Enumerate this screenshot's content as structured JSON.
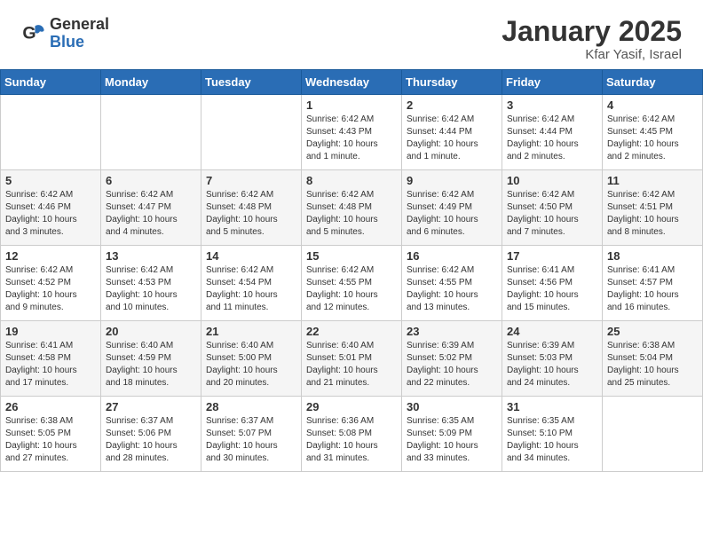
{
  "logo": {
    "general": "General",
    "blue": "Blue"
  },
  "title": "January 2025",
  "location": "Kfar Yasif, Israel",
  "weekdays": [
    "Sunday",
    "Monday",
    "Tuesday",
    "Wednesday",
    "Thursday",
    "Friday",
    "Saturday"
  ],
  "weeks": [
    [
      {
        "day": "",
        "info": ""
      },
      {
        "day": "",
        "info": ""
      },
      {
        "day": "",
        "info": ""
      },
      {
        "day": "1",
        "info": "Sunrise: 6:42 AM\nSunset: 4:43 PM\nDaylight: 10 hours\nand 1 minute."
      },
      {
        "day": "2",
        "info": "Sunrise: 6:42 AM\nSunset: 4:44 PM\nDaylight: 10 hours\nand 1 minute."
      },
      {
        "day": "3",
        "info": "Sunrise: 6:42 AM\nSunset: 4:44 PM\nDaylight: 10 hours\nand 2 minutes."
      },
      {
        "day": "4",
        "info": "Sunrise: 6:42 AM\nSunset: 4:45 PM\nDaylight: 10 hours\nand 2 minutes."
      }
    ],
    [
      {
        "day": "5",
        "info": "Sunrise: 6:42 AM\nSunset: 4:46 PM\nDaylight: 10 hours\nand 3 minutes."
      },
      {
        "day": "6",
        "info": "Sunrise: 6:42 AM\nSunset: 4:47 PM\nDaylight: 10 hours\nand 4 minutes."
      },
      {
        "day": "7",
        "info": "Sunrise: 6:42 AM\nSunset: 4:48 PM\nDaylight: 10 hours\nand 5 minutes."
      },
      {
        "day": "8",
        "info": "Sunrise: 6:42 AM\nSunset: 4:48 PM\nDaylight: 10 hours\nand 5 minutes."
      },
      {
        "day": "9",
        "info": "Sunrise: 6:42 AM\nSunset: 4:49 PM\nDaylight: 10 hours\nand 6 minutes."
      },
      {
        "day": "10",
        "info": "Sunrise: 6:42 AM\nSunset: 4:50 PM\nDaylight: 10 hours\nand 7 minutes."
      },
      {
        "day": "11",
        "info": "Sunrise: 6:42 AM\nSunset: 4:51 PM\nDaylight: 10 hours\nand 8 minutes."
      }
    ],
    [
      {
        "day": "12",
        "info": "Sunrise: 6:42 AM\nSunset: 4:52 PM\nDaylight: 10 hours\nand 9 minutes."
      },
      {
        "day": "13",
        "info": "Sunrise: 6:42 AM\nSunset: 4:53 PM\nDaylight: 10 hours\nand 10 minutes."
      },
      {
        "day": "14",
        "info": "Sunrise: 6:42 AM\nSunset: 4:54 PM\nDaylight: 10 hours\nand 11 minutes."
      },
      {
        "day": "15",
        "info": "Sunrise: 6:42 AM\nSunset: 4:55 PM\nDaylight: 10 hours\nand 12 minutes."
      },
      {
        "day": "16",
        "info": "Sunrise: 6:42 AM\nSunset: 4:55 PM\nDaylight: 10 hours\nand 13 minutes."
      },
      {
        "day": "17",
        "info": "Sunrise: 6:41 AM\nSunset: 4:56 PM\nDaylight: 10 hours\nand 15 minutes."
      },
      {
        "day": "18",
        "info": "Sunrise: 6:41 AM\nSunset: 4:57 PM\nDaylight: 10 hours\nand 16 minutes."
      }
    ],
    [
      {
        "day": "19",
        "info": "Sunrise: 6:41 AM\nSunset: 4:58 PM\nDaylight: 10 hours\nand 17 minutes."
      },
      {
        "day": "20",
        "info": "Sunrise: 6:40 AM\nSunset: 4:59 PM\nDaylight: 10 hours\nand 18 minutes."
      },
      {
        "day": "21",
        "info": "Sunrise: 6:40 AM\nSunset: 5:00 PM\nDaylight: 10 hours\nand 20 minutes."
      },
      {
        "day": "22",
        "info": "Sunrise: 6:40 AM\nSunset: 5:01 PM\nDaylight: 10 hours\nand 21 minutes."
      },
      {
        "day": "23",
        "info": "Sunrise: 6:39 AM\nSunset: 5:02 PM\nDaylight: 10 hours\nand 22 minutes."
      },
      {
        "day": "24",
        "info": "Sunrise: 6:39 AM\nSunset: 5:03 PM\nDaylight: 10 hours\nand 24 minutes."
      },
      {
        "day": "25",
        "info": "Sunrise: 6:38 AM\nSunset: 5:04 PM\nDaylight: 10 hours\nand 25 minutes."
      }
    ],
    [
      {
        "day": "26",
        "info": "Sunrise: 6:38 AM\nSunset: 5:05 PM\nDaylight: 10 hours\nand 27 minutes."
      },
      {
        "day": "27",
        "info": "Sunrise: 6:37 AM\nSunset: 5:06 PM\nDaylight: 10 hours\nand 28 minutes."
      },
      {
        "day": "28",
        "info": "Sunrise: 6:37 AM\nSunset: 5:07 PM\nDaylight: 10 hours\nand 30 minutes."
      },
      {
        "day": "29",
        "info": "Sunrise: 6:36 AM\nSunset: 5:08 PM\nDaylight: 10 hours\nand 31 minutes."
      },
      {
        "day": "30",
        "info": "Sunrise: 6:35 AM\nSunset: 5:09 PM\nDaylight: 10 hours\nand 33 minutes."
      },
      {
        "day": "31",
        "info": "Sunrise: 6:35 AM\nSunset: 5:10 PM\nDaylight: 10 hours\nand 34 minutes."
      },
      {
        "day": "",
        "info": ""
      }
    ]
  ]
}
